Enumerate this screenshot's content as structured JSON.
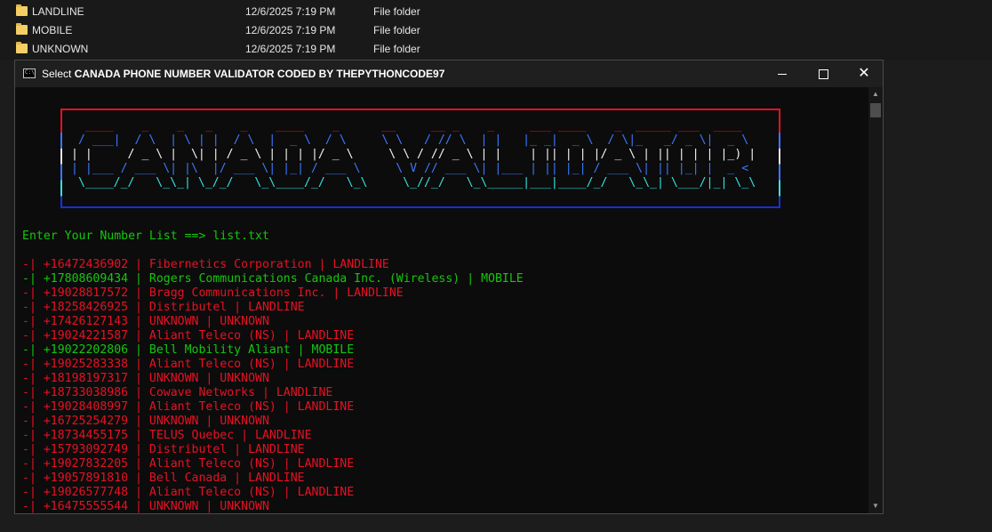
{
  "explorer": {
    "rows": [
      {
        "name": "LANDLINE",
        "date": "12/6/2025 7:19 PM",
        "type": "File folder"
      },
      {
        "name": "MOBILE",
        "date": "12/6/2025 7:19 PM",
        "type": "File folder"
      },
      {
        "name": "UNKNOWN",
        "date": "12/6/2025 7:19 PM",
        "type": "File folder"
      }
    ]
  },
  "window": {
    "title_prefix": "Select ",
    "title_bold": "CANADA PHONE NUMBER VALIDATOR CODED BY THEPYTHONCODE97",
    "icon_text": "C:\\",
    "min_icon": "minimize-icon",
    "max_icon": "maximize-icon",
    "close_glyph": "✕"
  },
  "banner": {
    "line1": "  ____    _    _   _    _    ____    _      __     __ _    _     ___ ____    _  _____ ___  ____  ",
    "line2": " / ___|  / \\  | \\ | |  / \\  |  _ \\  / \\     \\ \\   / // \\  | |   |_ _|  _ \\  / \\|_   _/ _ \\|  _ \\ ",
    "line3": "| |     / _ \\ |  \\| | / _ \\ | | | |/ _ \\     \\ \\ / // _ \\ | |    | || | | |/ _ \\ | || | | | |_) |",
    "line4": "| |___ / ___ \\| |\\  |/ ___ \\| |_| / ___ \\     \\ V // ___ \\| |___ | || |_| / ___ \\| || |_| |  _ < ",
    "line5": " \\____/_/   \\_\\_| \\_/_/   \\_\\____/_/   \\_\\     \\_//_/   \\_\\_____|___|____/_/   \\_\\_| \\___/|_| \\_\\",
    "colors": {
      "top": "#e81123",
      "mid": "#3b78ff",
      "white": "#f2f2f2",
      "cyan": "#34e2e2",
      "bottom": "#1b2fd8"
    }
  },
  "prompt": {
    "text": "Enter Your Number List ==> list.txt"
  },
  "results": [
    {
      "text": "-| +16472436902 | Fibernetics Corporation | LANDLINE",
      "status": "LANDLINE"
    },
    {
      "text": "-| +17808609434 | Rogers Communications Canada Inc. (Wireless) | MOBILE",
      "status": "MOBILE"
    },
    {
      "text": "-| +19028817572 | Bragg Communications Inc. | LANDLINE",
      "status": "LANDLINE"
    },
    {
      "text": "-| +18258426925 | Distributel | LANDLINE",
      "status": "LANDLINE"
    },
    {
      "text": "-| +17426127143 | UNKNOWN | UNKNOWN",
      "status": "UNKNOWN"
    },
    {
      "text": "-| +19024221587 | Aliant Teleco (NS) | LANDLINE",
      "status": "LANDLINE"
    },
    {
      "text": "-| +19022202806 | Bell Mobility Aliant | MOBILE",
      "status": "MOBILE"
    },
    {
      "text": "-| +19025283338 | Aliant Teleco (NS) | LANDLINE",
      "status": "LANDLINE"
    },
    {
      "text": "-| +18198197317 | UNKNOWN | UNKNOWN",
      "status": "UNKNOWN"
    },
    {
      "text": "-| +18733038986 | Cowave Networks | LANDLINE",
      "status": "LANDLINE"
    },
    {
      "text": "-| +19028408997 | Aliant Teleco (NS) | LANDLINE",
      "status": "LANDLINE"
    },
    {
      "text": "-| +16725254279 | UNKNOWN | UNKNOWN",
      "status": "UNKNOWN"
    },
    {
      "text": "-| +18734455175 | TELUS Quebec | LANDLINE",
      "status": "LANDLINE"
    },
    {
      "text": "-| +15793092749 | Distributel | LANDLINE",
      "status": "LANDLINE"
    },
    {
      "text": "-| +19027832205 | Aliant Teleco (NS) | LANDLINE",
      "status": "LANDLINE"
    },
    {
      "text": "-| +19057891810 | Bell Canada | LANDLINE",
      "status": "LANDLINE"
    },
    {
      "text": "-| +19026577748 | Aliant Teleco (NS) | LANDLINE",
      "status": "LANDLINE"
    },
    {
      "text": "-| +16475555544 | UNKNOWN | UNKNOWN",
      "status": "UNKNOWN"
    }
  ],
  "colors": {
    "landline": "#e81123",
    "mobile": "#16c60c",
    "unknown": "#e81123",
    "prompt": "#16c60c"
  }
}
